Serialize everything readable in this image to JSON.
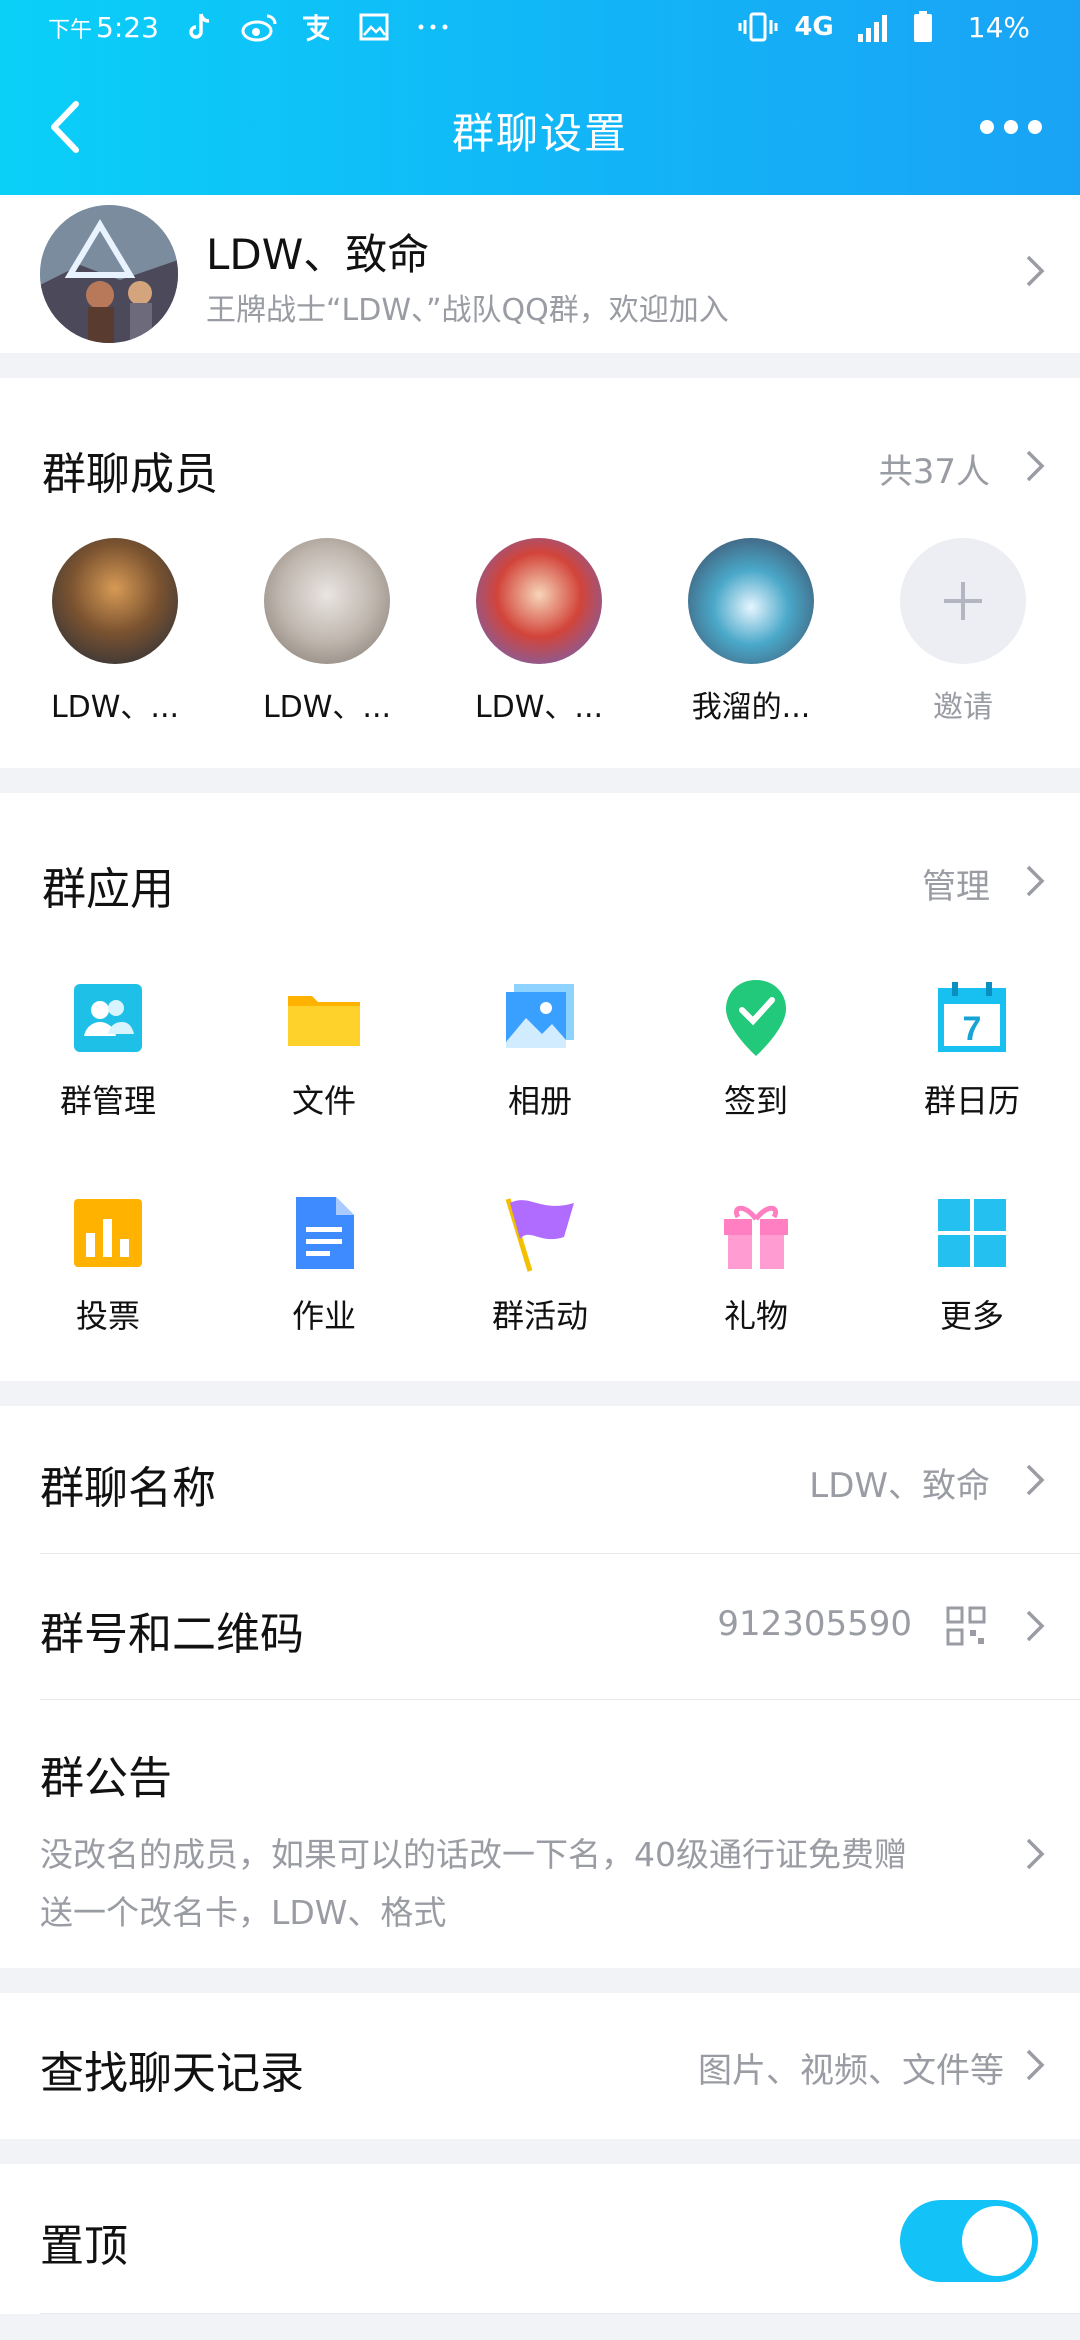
{
  "status_bar": {
    "time_prefix": "下午",
    "time": "5:23",
    "network": "4G",
    "battery": "14%"
  },
  "nav": {
    "title": "群聊设置"
  },
  "group": {
    "name": "LDW、致命",
    "description": "王牌战士“LDW、”战队QQ群，欢迎加入"
  },
  "members": {
    "title": "群聊成员",
    "count": "共37人",
    "list": [
      "LDW、...",
      "LDW、...",
      "LDW、...",
      "我溜的..."
    ],
    "invite_label": "邀请"
  },
  "apps": {
    "title": "群应用",
    "manage_label": "管理",
    "items": [
      "群管理",
      "文件",
      "相册",
      "签到",
      "群日历",
      "投票",
      "作业",
      "群活动",
      "礼物",
      "更多"
    ],
    "calendar_day": "7"
  },
  "settings": {
    "group_name_label": "群聊名称",
    "group_name_value": "LDW、致命",
    "group_number_label": "群号和二维码",
    "group_number_value": "912305590",
    "announcement_label": "群公告",
    "announcement_text_line1": "没改名的成员，如果可以的话改一下名，40级通行证免费赠",
    "announcement_text_line2": "送一个改名卡，LDW、格式",
    "search_label": "查找聊天记录",
    "search_hint": "图片、视频、文件等",
    "pin_label": "置顶",
    "pin_enabled": true
  },
  "colors": {
    "header_start": "#0ad0f8",
    "header_end": "#1aa3f5",
    "toggle_on": "#13c2f7",
    "secondary_text": "#9a9ca3"
  }
}
